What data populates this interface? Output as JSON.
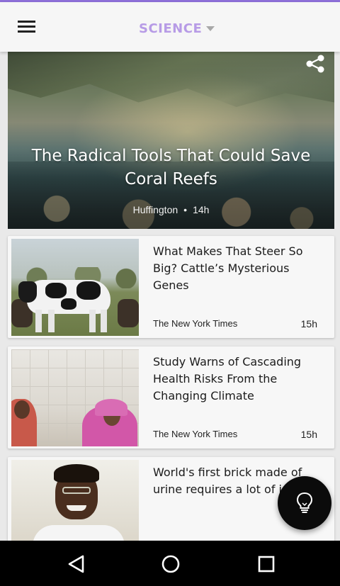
{
  "appbar": {
    "category_label": "SCIENCE"
  },
  "hero": {
    "title": "The Radical Tools That Could Save Coral Reefs",
    "source": "Huffington",
    "separator": "•",
    "time": "14h"
  },
  "articles": [
    {
      "title": "What Makes That Steer So Big? Cattle’s Mysterious Genes",
      "source": "The New York Times",
      "time": "15h"
    },
    {
      "title": "Study Warns of Cascading Health Risks From the Changing Climate",
      "source": "The New York Times",
      "time": "15h"
    },
    {
      "title": "World's first brick made of urine requires a lot of i",
      "source": "",
      "time": ""
    }
  ],
  "icons": {
    "menu": "hamburger-menu-icon",
    "dropdown": "caret-down-icon",
    "share": "share-icon",
    "fab": "lightbulb-icon",
    "nav_back": "triangle-back-icon",
    "nav_home": "circle-home-icon",
    "nav_recents": "square-recents-icon"
  },
  "colors": {
    "accent": "#b79be6",
    "top_line": "#8e6fd8",
    "fab": "#0b0b0b"
  }
}
